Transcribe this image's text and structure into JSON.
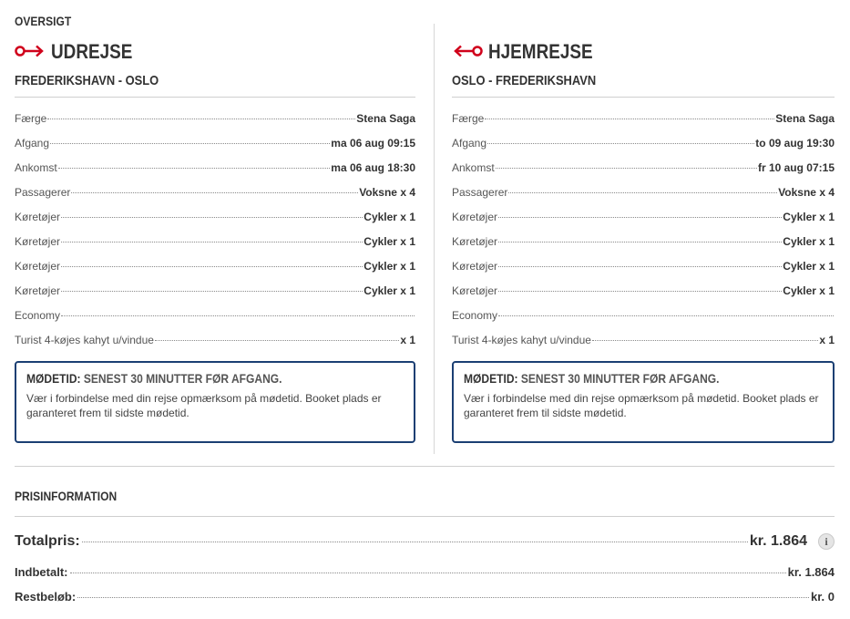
{
  "overview": {
    "title": "OVERSIGT"
  },
  "outbound": {
    "title": "UDREJSE",
    "route": "FREDERIKSHAVN - OSLO",
    "arrow_icon": "arrow-right-icon",
    "rows": [
      {
        "label": "Færge",
        "value": "Stena Saga"
      },
      {
        "label": "Afgang",
        "value": "ma 06 aug 09:15"
      },
      {
        "label": "Ankomst",
        "value": "ma 06 aug 18:30"
      },
      {
        "label": "Passagerer",
        "value": "Voksne x 4"
      },
      {
        "label": "Køretøjer",
        "value": "Cykler x 1"
      },
      {
        "label": "Køretøjer",
        "value": "Cykler x 1"
      },
      {
        "label": "Køretøjer",
        "value": "Cykler x 1"
      },
      {
        "label": "Køretøjer",
        "value": "Cykler x 1"
      },
      {
        "label": "Economy",
        "value": ""
      },
      {
        "label": "Turist 4-køjes kahyt u/vindue",
        "value": "x 1"
      }
    ],
    "notice": {
      "title_highlight": "MØDETID:",
      "title_rest": "SENEST 30 MINUTTER FØR AFGANG.",
      "text": "Vær i forbindelse med din rejse opmærksom på mødetid. Booket plads er garanteret frem til sidste mødetid."
    }
  },
  "return": {
    "title": "HJEMREJSE",
    "route": "OSLO - FREDERIKSHAVN",
    "arrow_icon": "arrow-left-icon",
    "rows": [
      {
        "label": "Færge",
        "value": "Stena Saga"
      },
      {
        "label": "Afgang",
        "value": "to 09 aug 19:30"
      },
      {
        "label": "Ankomst",
        "value": "fr 10 aug 07:15"
      },
      {
        "label": "Passagerer",
        "value": "Voksne x 4"
      },
      {
        "label": "Køretøjer",
        "value": "Cykler x 1"
      },
      {
        "label": "Køretøjer",
        "value": "Cykler x 1"
      },
      {
        "label": "Køretøjer",
        "value": "Cykler x 1"
      },
      {
        "label": "Køretøjer",
        "value": "Cykler x 1"
      },
      {
        "label": "Economy",
        "value": ""
      },
      {
        "label": "Turist 4-køjes kahyt u/vindue",
        "value": "x 1"
      }
    ],
    "notice": {
      "title_highlight": "MØDETID:",
      "title_rest": "SENEST 30 MINUTTER FØR AFGANG.",
      "text": "Vær i forbindelse med din rejse opmærksom på mødetid. Booket plads er garanteret frem til sidste mødetid."
    }
  },
  "price": {
    "title": "PRISINFORMATION",
    "total_label": "Totalpris:",
    "total_value": "kr. 1.864",
    "paid_label": "Indbetalt:",
    "paid_value": "kr. 1.864",
    "rest_label": "Restbeløb:",
    "rest_value": "kr. 0",
    "info_icon": "info-icon"
  },
  "colors": {
    "accent_red": "#d0021b",
    "notice_border": "#1b3f73"
  }
}
